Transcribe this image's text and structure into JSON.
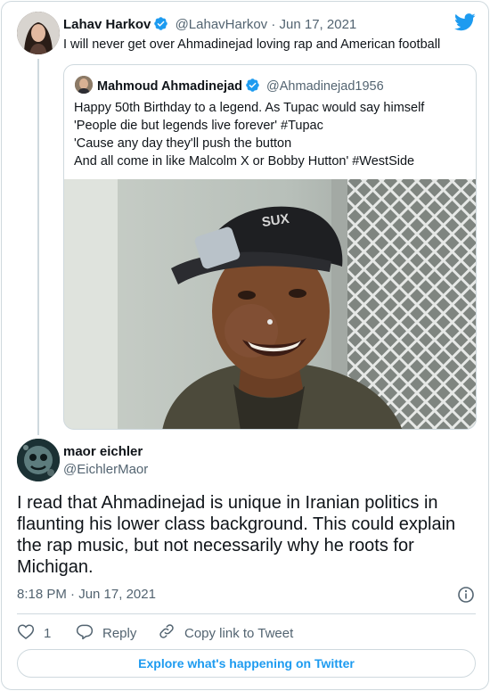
{
  "parent": {
    "name": "Lahav Harkov",
    "handle": "@LahavHarkov",
    "date": "· Jun 17, 2021",
    "text": "I will never get over Ahmadinejad loving rap and American football"
  },
  "quote": {
    "name": "Mahmoud Ahmadinejad",
    "handle": "@Ahmadinejad1956",
    "lines": [
      "Happy 50th Birthday to a legend. As Tupac would say himself",
      "'People die but legends live forever' #Tupac",
      "'Cause any day they'll push the button",
      "And all come in like Malcolm X or Bobby Hutton' #WestSide"
    ],
    "photo_cap_text": "SUX"
  },
  "reply": {
    "name": "maor eichler",
    "handle": "@EichlerMaor",
    "lines": [
      "I read that Ahmadinejad is unique in Iranian politics in",
      "flaunting his lower class background. This could explain",
      "the rap music, but not necessarily why he roots for",
      "Michigan."
    ],
    "time": "8:18 PM · Jun 17, 2021"
  },
  "actions": {
    "like_count": "1",
    "reply_label": "Reply",
    "copy_label": "Copy link to Tweet"
  },
  "explore_label": "Explore what's happening on Twitter",
  "colors": {
    "brand": "#1d9bf0",
    "muted": "#536471",
    "border": "#cfd9de"
  }
}
